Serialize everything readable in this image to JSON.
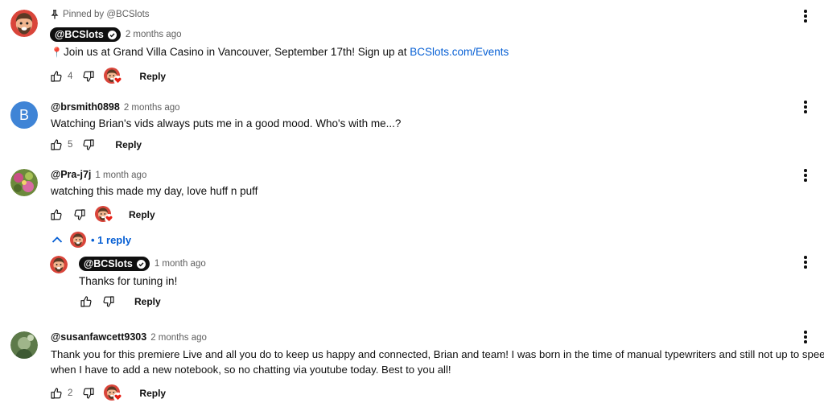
{
  "comments": [
    {
      "pinned_text": "Pinned by @BCSlots",
      "author": "@BCSlots",
      "time": "2 months ago",
      "text": "Join us at Grand Villa Casino in Vancouver, September 17th! Sign up at ",
      "link": "BCSlots.com/Events",
      "likes": "4",
      "reply_label": "Reply"
    },
    {
      "avatar_letter": "B",
      "author": "@brsmith0898",
      "time": "2 months ago",
      "text": "Watching Brian's vids always puts me in a good mood. Who's with me...?",
      "likes": "5",
      "reply_label": "Reply"
    },
    {
      "author": "@Pra-j7j",
      "time": "1 month ago",
      "text": "watching this made my day, love huff n puff",
      "reply_label": "Reply",
      "replies_toggle": "• 1 reply",
      "reply": {
        "author": "@BCSlots",
        "time": "1 month ago",
        "text": "Thanks for tuning in!",
        "reply_label": "Reply"
      }
    },
    {
      "author": "@susanfawcett9303",
      "time": "2 months ago",
      "text_line1": "Thank you for this premiere Live and all you do to keep us happy and connected, Brian and team!  I was born in the time of manual typewriters and still not up to speed",
      "text_line2": "when I have to add a new notebook, so no chatting via youtube today.  Best to you all!",
      "likes": "2",
      "reply_label": "Reply"
    }
  ],
  "colors": {
    "link": "#065fd4",
    "text": "#0f0f0f",
    "meta": "#606060",
    "avatar_b": "#3f84d6",
    "heart": "#e62117"
  }
}
